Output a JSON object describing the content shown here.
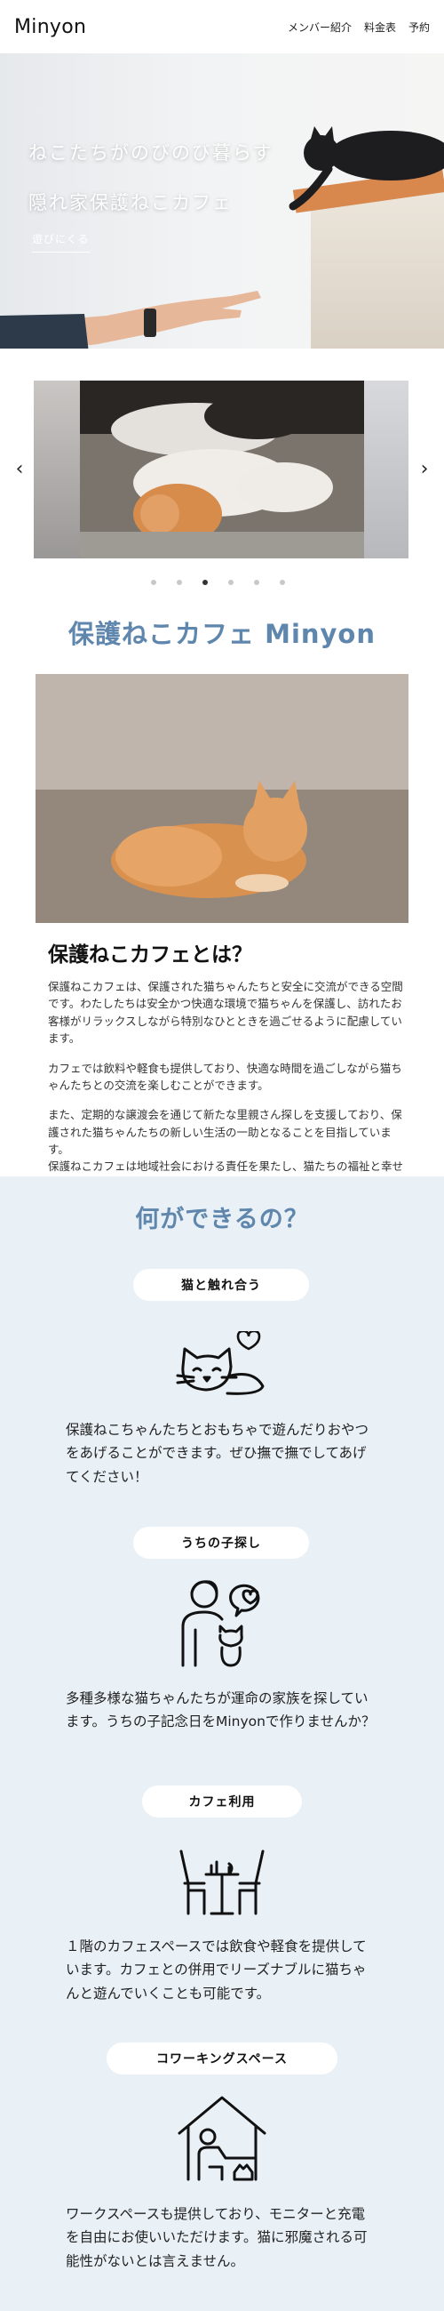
{
  "header": {
    "logo": "Minyon",
    "nav": [
      "メンバー紹介",
      "料金表",
      "予約"
    ]
  },
  "hero": {
    "title_line1": "ねこたちがのびのび暮らす",
    "title_line2": "隠れ家保護ねこカフェ",
    "link": "遊びにくる"
  },
  "carousel": {
    "prev_icon": "chevron-left-icon",
    "next_icon": "chevron-right-icon",
    "prev_glyph": "‹",
    "next_glyph": "›",
    "dot_count": 6,
    "active_index": 2
  },
  "about": {
    "heading": "保護ねこカフェ Minyon",
    "subheading": "保護ねこカフェとは？",
    "paragraphs": [
      "保護ねこカフェは、保護された猫ちゃんたちと安全に交流ができる空間です。わたしたちは安全かつ快適な環境で猫ちゃんを保護し、訪れたお客様がリラックスしながら特別なひとときを過ごせるように配慮しています。",
      "カフェでは飲料や軽食も提供しており、快適な時間を過ごしながら猫ちゃんたちとの交流を楽しむことができます。",
      "また、定期的な譲渡会を通じて新たな里親さん探しを支援しており、保護された猫ちゃんたちの新しい生活の一助となることを目指しています。",
      "保護ねこカフェは地域社会における責任を果たし、猫たちの福祉と幸せな未来をサポートすることを使命としています。"
    ]
  },
  "features": {
    "heading": "何ができるの？",
    "items": [
      {
        "label": "猫と触れ合う",
        "icon": "cat-heart-icon",
        "text": "保護ねこちゃんたちとおもちゃで遊んだりおやつをあげることができます。ぜひ撫で撫でしてあげてください！"
      },
      {
        "label": "うちの子探し",
        "icon": "person-cat-icon",
        "text": "多種多様な猫ちゃんたちが運命の家族を探しています。うちの子記念日をMinyonで作りませんか？"
      },
      {
        "label": "カフェ利用",
        "icon": "cafe-table-icon",
        "text": "１階のカフェスペースでは飲食や軽食を提供しています。カフェとの併用でリーズナブルに猫ちゃんと遊んでいくことも可能です。"
      },
      {
        "label": "コワーキングスペース",
        "icon": "home-office-icon",
        "text": "ワークスペースも提供しており、モニターと充電を自由にお使いいただけます。猫に邪魔される可能性がないとは言えません。"
      }
    ]
  },
  "colors": {
    "accent": "#5f86ad",
    "features_bg": "#e9f0f6"
  }
}
